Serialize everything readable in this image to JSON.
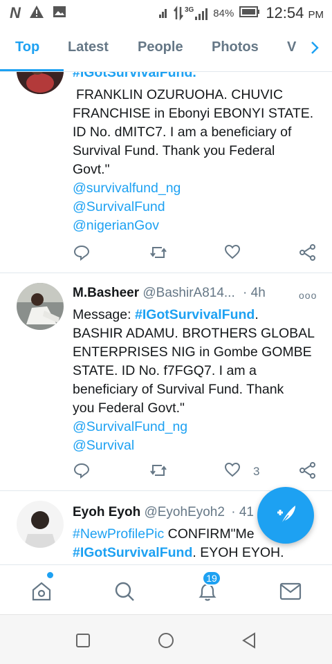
{
  "status_bar": {
    "network_label": "3G",
    "battery": "84%",
    "time": "12:54",
    "ampm": "PM",
    "icons": [
      "n-icon",
      "warning-icon",
      "image-icon",
      "vibrate-icon",
      "signal-icon",
      "battery-icon"
    ]
  },
  "tabs": [
    "Top",
    "Latest",
    "People",
    "Photos",
    "V"
  ],
  "colors": {
    "accent": "#1da1f2",
    "secondary_text": "#657786",
    "divider": "#e1e8ed"
  },
  "tweets": [
    {
      "partial_top": "#IGotSurvivalFund.",
      "lines": [
        "FRANKLIN OZURUOHA. CHUVIC",
        "FRANCHISE in Ebonyi EBONYI STATE.",
        "ID No. dMITC7. I am a beneficiary of",
        "Survival Fund. Thank you Federal",
        "Govt.\""
      ],
      "mentions": [
        "@survivalfund_ng",
        "@SurvivalFund",
        "@nigerianGov"
      ]
    },
    {
      "name": "M.Basheer",
      "handle": "@BashirA814...",
      "time": "· 4h",
      "more": "ooo",
      "prefix": "Message: ",
      "hashtag": "#IGotSurvivalFund",
      "lines_after": [
        ".",
        "BASHIR ADAMU. BROTHERS GLOBAL",
        "ENTERPRISES NIG in Gombe GOMBE",
        "STATE. ID No. f7FGQ7. I am a",
        "beneficiary of Survival Fund. Thank",
        "you Federal Govt.\""
      ],
      "mentions": [
        "@SurvivalFund_ng",
        "@Survival"
      ],
      "like_count": "3"
    },
    {
      "name": "Eyoh Eyoh",
      "handle": "@EyohEyoh2",
      "time": "· 41",
      "hashtag1": "#NewProfilePic",
      "text1": " CONFIRM\"Me",
      "hashtag2": "#IGotSurvivalFund",
      "text2": ". EYOH EYOH."
    }
  ],
  "bottom_nav": {
    "notification_count": "19"
  }
}
